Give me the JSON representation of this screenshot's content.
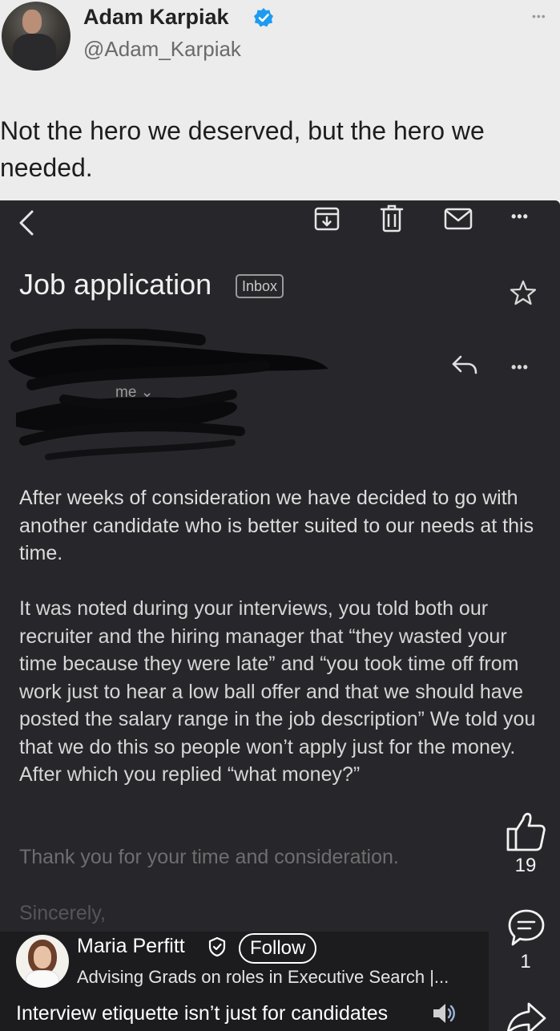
{
  "tweet": {
    "author_name": "Adam Karpiak",
    "author_handle": "@Adam_Karpiak",
    "more_icon": "more-dots-icon",
    "text": "Not the hero we deserved, but the hero we needed."
  },
  "email": {
    "toolbar_icons": [
      "back-icon",
      "archive-icon",
      "trash-icon",
      "mail-icon",
      "more-icon"
    ],
    "subject": "Job application",
    "label": "Inbox",
    "recipient": "me ⌄",
    "paragraphs": [
      "After weeks of consideration we have decided to go with another candidate who is better suited to our needs at this time.",
      "It was noted during your interviews, you told both our recruiter and the hiring manager that “they wasted your time because they were late” and “you took time off from work just to hear a low ball offer and that we should have posted the salary range in the job description” We told you that we do this so people won’t apply just for the money. After which you replied “what money?”",
      "Thank you for your time and consideration.",
      "Sincerely,"
    ]
  },
  "actions": {
    "like_count": "19",
    "comment_count": "1"
  },
  "post": {
    "poster_name": "Maria Perfitt",
    "follow_label": "Follow",
    "headline": "Advising Grads on roles in Executive Search |...",
    "caption": "Interview etiquette isn’t just for candidates"
  },
  "colors": {
    "verified_blue": "#1d9bf0",
    "email_background": "#27272b",
    "tweet_background": "#ececec"
  }
}
